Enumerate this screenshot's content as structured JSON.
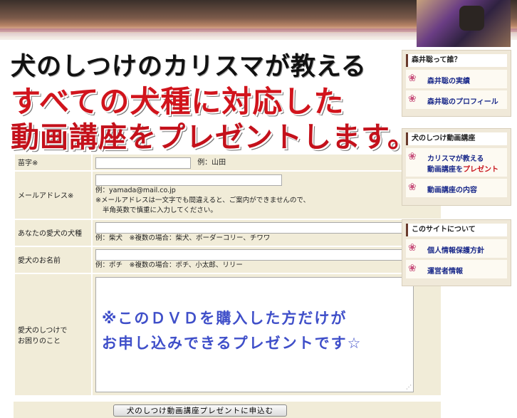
{
  "headline": {
    "line1": "犬のしつけのカリスマが教える",
    "line2": "すべての犬種に対応した",
    "line3": "動画講座をプレゼントします。"
  },
  "form": {
    "surname": {
      "label": "苗字※",
      "example": "例：山田"
    },
    "email": {
      "label": "メールアドレス※",
      "example": "例：yamada@mail.co.jp",
      "note1": "※メールアドレスは一文字でも間違えると、ご案内ができませんので、",
      "note2": "半角英数で慎重に入力してください。"
    },
    "breed": {
      "label": "あなたの愛犬の犬種",
      "example": "例：柴犬　※複数の場合：柴犬、ボーダーコリー、チワワ"
    },
    "dogname": {
      "label": "愛犬のお名前",
      "example": "例：ポチ　※複数の場合：ポチ、小太郎、リリー"
    },
    "trouble": {
      "label_line1": "愛犬のしつけで",
      "label_line2": "お困りのこと",
      "overlay_line1": "※このＤＶＤを購入した方だけが",
      "overlay_line2": "お申し込みできるプレゼントです☆"
    },
    "submit_label": "犬のしつけ動画講座プレゼントに申込む"
  },
  "sidebar": {
    "box1": {
      "title": "森井聡って誰？",
      "items": [
        "森井聡の実績",
        "森井聡のプロフィール"
      ]
    },
    "box2": {
      "title": "犬のしつけ動画講座",
      "item1_line1": "カリスマが教える",
      "item1_line2": "動画講座を",
      "item1_line2_red": "プレゼント",
      "item2": "動画講座の内容"
    },
    "box3": {
      "title": "このサイトについて",
      "items": [
        "個人情報保護方針",
        "運営者情報"
      ]
    }
  },
  "icons": {
    "paw": "paw-icon"
  }
}
